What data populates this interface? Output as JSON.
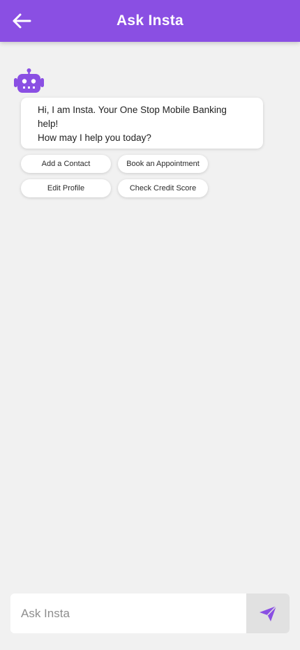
{
  "colors": {
    "accent": "#8a4fe3",
    "background": "#f1f1f1"
  },
  "header": {
    "title": "Ask Insta",
    "back_icon": "arrow-left-icon"
  },
  "chat": {
    "bot_icon": "robot-icon",
    "messages": [
      {
        "sender": "bot",
        "lines": [
          "Hi, I am Insta. Your One Stop Mobile Banking",
          "help!",
          "How may I help you today?"
        ]
      }
    ],
    "quick_replies": [
      "Add a Contact",
      "Book an Appointment",
      "Edit Profile",
      "Check Credit Score"
    ]
  },
  "composer": {
    "placeholder": "Ask Insta",
    "value": "",
    "send_icon": "send-icon"
  }
}
